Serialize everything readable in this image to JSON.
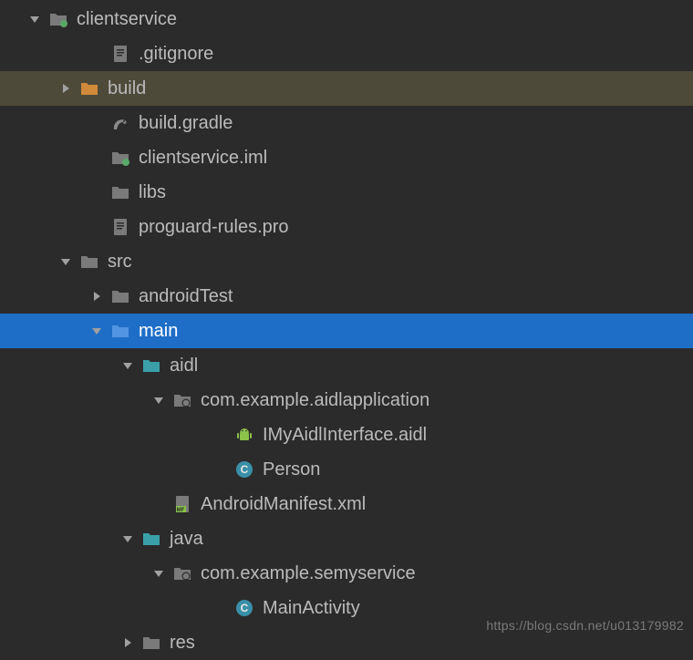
{
  "tree": [
    {
      "indent": 28,
      "arrow": "down",
      "icon": "folder-module",
      "label": "clientservice",
      "interact": true
    },
    {
      "indent": 96,
      "arrow": "",
      "icon": "file-text",
      "label": ".gitignore",
      "interact": true
    },
    {
      "indent": 62,
      "arrow": "right",
      "icon": "folder-orange",
      "label": "build",
      "interact": true,
      "rowStyle": "highlight-build"
    },
    {
      "indent": 96,
      "arrow": "",
      "icon": "gradle",
      "label": "build.gradle",
      "interact": true
    },
    {
      "indent": 96,
      "arrow": "",
      "icon": "folder-module",
      "label": "clientservice.iml",
      "interact": true
    },
    {
      "indent": 96,
      "arrow": "",
      "icon": "folder-gray",
      "label": "libs",
      "interact": true
    },
    {
      "indent": 96,
      "arrow": "",
      "icon": "file-text",
      "label": "proguard-rules.pro",
      "interact": true
    },
    {
      "indent": 62,
      "arrow": "down",
      "icon": "folder-gray",
      "label": "src",
      "interact": true
    },
    {
      "indent": 96,
      "arrow": "right",
      "icon": "folder-gray",
      "label": "androidTest",
      "interact": true
    },
    {
      "indent": 96,
      "arrow": "down",
      "icon": "folder-blue",
      "label": "main",
      "interact": true,
      "rowStyle": "highlight-selected"
    },
    {
      "indent": 130,
      "arrow": "down",
      "icon": "folder-teal",
      "label": "aidl",
      "interact": true
    },
    {
      "indent": 164,
      "arrow": "down",
      "icon": "package",
      "label": "com.example.aidlapplication",
      "interact": true
    },
    {
      "indent": 232,
      "arrow": "",
      "icon": "android",
      "label": "IMyAidlInterface.aidl",
      "interact": true
    },
    {
      "indent": 232,
      "arrow": "",
      "icon": "class",
      "label": "Person",
      "interact": true
    },
    {
      "indent": 164,
      "arrow": "",
      "icon": "manifest",
      "label": "AndroidManifest.xml",
      "interact": true
    },
    {
      "indent": 130,
      "arrow": "down",
      "icon": "folder-teal",
      "label": "java",
      "interact": true
    },
    {
      "indent": 164,
      "arrow": "down",
      "icon": "package",
      "label": "com.example.semyservice",
      "interact": true
    },
    {
      "indent": 232,
      "arrow": "",
      "icon": "class",
      "label": "MainActivity",
      "interact": true
    },
    {
      "indent": 130,
      "arrow": "right",
      "icon": "folder-gray",
      "label": "res",
      "interact": true
    }
  ],
  "watermark": "https://blog.csdn.net/u013179982"
}
